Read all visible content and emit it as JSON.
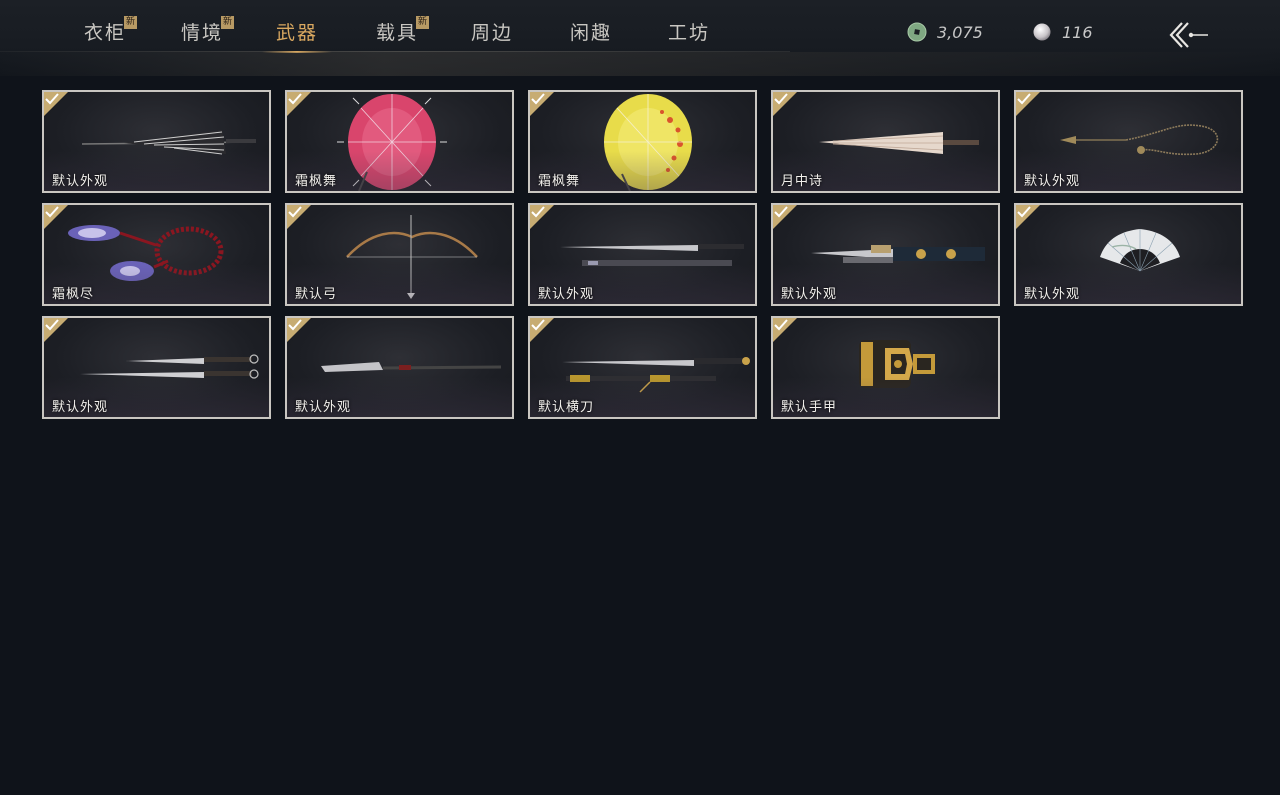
{
  "nav": {
    "tabs": [
      {
        "label": "衣柜",
        "badge": "新",
        "active": false
      },
      {
        "label": "情境",
        "badge": "新",
        "active": false
      },
      {
        "label": "武器",
        "badge": "",
        "active": true
      },
      {
        "label": "载具",
        "badge": "新",
        "active": false
      },
      {
        "label": "周边",
        "badge": "",
        "active": false
      },
      {
        "label": "闲趣",
        "badge": "",
        "active": false
      },
      {
        "label": "工坊",
        "badge": "",
        "active": false
      }
    ]
  },
  "currency": {
    "jade_amount": "3,075",
    "pearl_amount": "116",
    "jade_icon": "jade-coin-icon",
    "pearl_icon": "pearl-icon"
  },
  "back_icon": "back-arrow-icon",
  "colors": {
    "active_tab": "#d9a860",
    "badge": "#b89a64",
    "check_badge": "#c7ac72",
    "card_border": "#c9c6c1",
    "background": "#0f131a"
  },
  "items": [
    {
      "label": "默认外观",
      "icon": "closed-umbrella-icon",
      "equipped": true
    },
    {
      "label": "霜枫舞",
      "icon": "pink-parasol-icon",
      "equipped": true
    },
    {
      "label": "霜枫舞",
      "icon": "yellow-parasol-icon",
      "equipped": true
    },
    {
      "label": "月中诗",
      "icon": "folded-parasol-icon",
      "equipped": true
    },
    {
      "label": "默认外观",
      "icon": "rope-dart-icon",
      "equipped": true
    },
    {
      "label": "霜枫尽",
      "icon": "meteor-hammer-icon",
      "equipped": true
    },
    {
      "label": "默认弓",
      "icon": "bow-icon",
      "equipped": true
    },
    {
      "label": "默认外观",
      "icon": "sword-and-scabbard-icon",
      "equipped": true
    },
    {
      "label": "默认外观",
      "icon": "ornate-spear-icon",
      "equipped": true
    },
    {
      "label": "默认外观",
      "icon": "folding-fan-icon",
      "equipped": true
    },
    {
      "label": "默认外观",
      "icon": "twin-blades-icon",
      "equipped": true
    },
    {
      "label": "默认外观",
      "icon": "glaive-icon",
      "equipped": true
    },
    {
      "label": "默认横刀",
      "icon": "hengdao-icon",
      "equipped": true
    },
    {
      "label": "默认手甲",
      "icon": "gauntlet-icon",
      "equipped": true
    }
  ]
}
